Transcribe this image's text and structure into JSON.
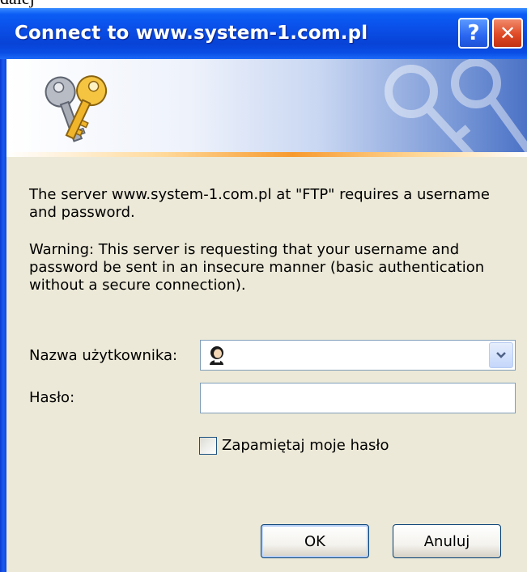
{
  "cropped_top_text": "dalej",
  "window": {
    "title": "Connect to www.system-1.com.pl",
    "help_glyph": "?",
    "close_glyph": "✕"
  },
  "banner": {
    "icon": "keys-icon"
  },
  "message": {
    "line1": "The server www.system-1.com.pl at \"FTP\" requires a username and password.",
    "warning": "Warning: This server is requesting that your username and password be sent in an insecure manner (basic authentication without a secure connection)."
  },
  "form": {
    "username_label": "Nazwa użytkownika:",
    "username_value": "",
    "password_label": "Hasło:",
    "password_value": "",
    "remember_label": "Zapamiętaj moje hasło",
    "remember_checked": false
  },
  "buttons": {
    "ok": "OK",
    "cancel": "Anuluj"
  },
  "colors": {
    "titlebar": "#0a4fe8",
    "dialog_bg": "#ece9d8",
    "close_button": "#df4a26",
    "accent_stripe": "#f79a2e"
  }
}
